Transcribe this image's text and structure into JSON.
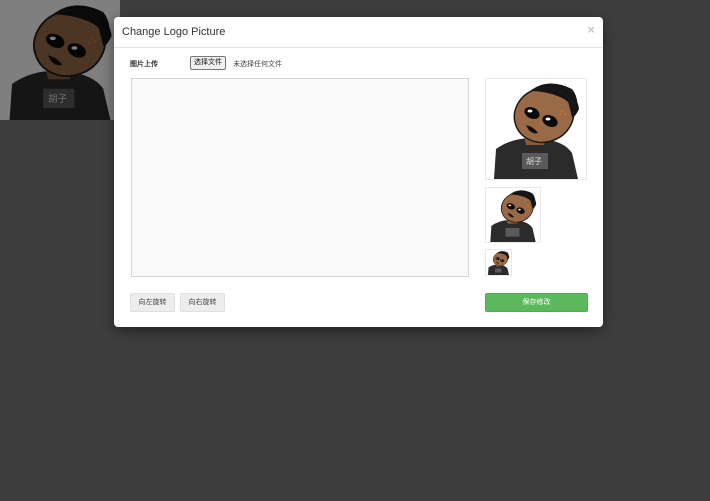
{
  "modal": {
    "title": "Change Logo Picture",
    "close_label": "×"
  },
  "upload": {
    "label": "图片上传",
    "choose_file_button": "选择文件",
    "file_status": "未选择任何文件"
  },
  "buttons": {
    "rotate_left": "向左旋转",
    "rotate_right": "向右旋转",
    "save": "保存修改"
  },
  "avatar": {
    "shirt_text": "胡子"
  },
  "colors": {
    "save_button": "#5cb85c",
    "backdrop": "#7d7d7d"
  }
}
